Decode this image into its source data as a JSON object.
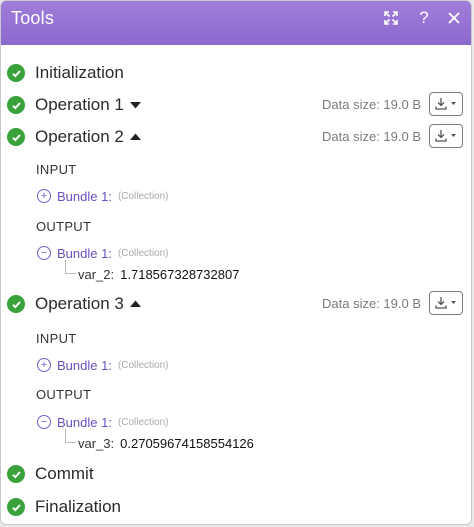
{
  "window": {
    "title": "Tools"
  },
  "steps": {
    "initialization": {
      "label": "Initialization"
    },
    "op1": {
      "label": "Operation 1",
      "data_size": "Data size: 19.0 B"
    },
    "op2": {
      "label": "Operation 2",
      "data_size": "Data size: 19.0 B",
      "input_label": "INPUT",
      "input_bundle": {
        "name": "Bundle 1:",
        "type": "(Collection)"
      },
      "output_label": "OUTPUT",
      "output_bundle": {
        "name": "Bundle 1:",
        "type": "(Collection)"
      },
      "var": {
        "name": "var_2:",
        "value": "1.718567328732807"
      }
    },
    "op3": {
      "label": "Operation 3",
      "data_size": "Data size: 19.0 B",
      "input_label": "INPUT",
      "input_bundle": {
        "name": "Bundle 1:",
        "type": "(Collection)"
      },
      "output_label": "OUTPUT",
      "output_bundle": {
        "name": "Bundle 1:",
        "type": "(Collection)"
      },
      "var": {
        "name": "var_3:",
        "value": "0.27059674158554126"
      }
    },
    "commit": {
      "label": "Commit"
    },
    "finalization": {
      "label": "Finalization"
    }
  },
  "colors": {
    "accent": "#8a68cf",
    "success": "#3aa23a",
    "bundle": "#6b4fc0"
  },
  "icons": {
    "expand": "expand-icon",
    "help": "help-icon",
    "close": "close-icon",
    "download": "download-icon",
    "check": "check-circle-icon"
  }
}
